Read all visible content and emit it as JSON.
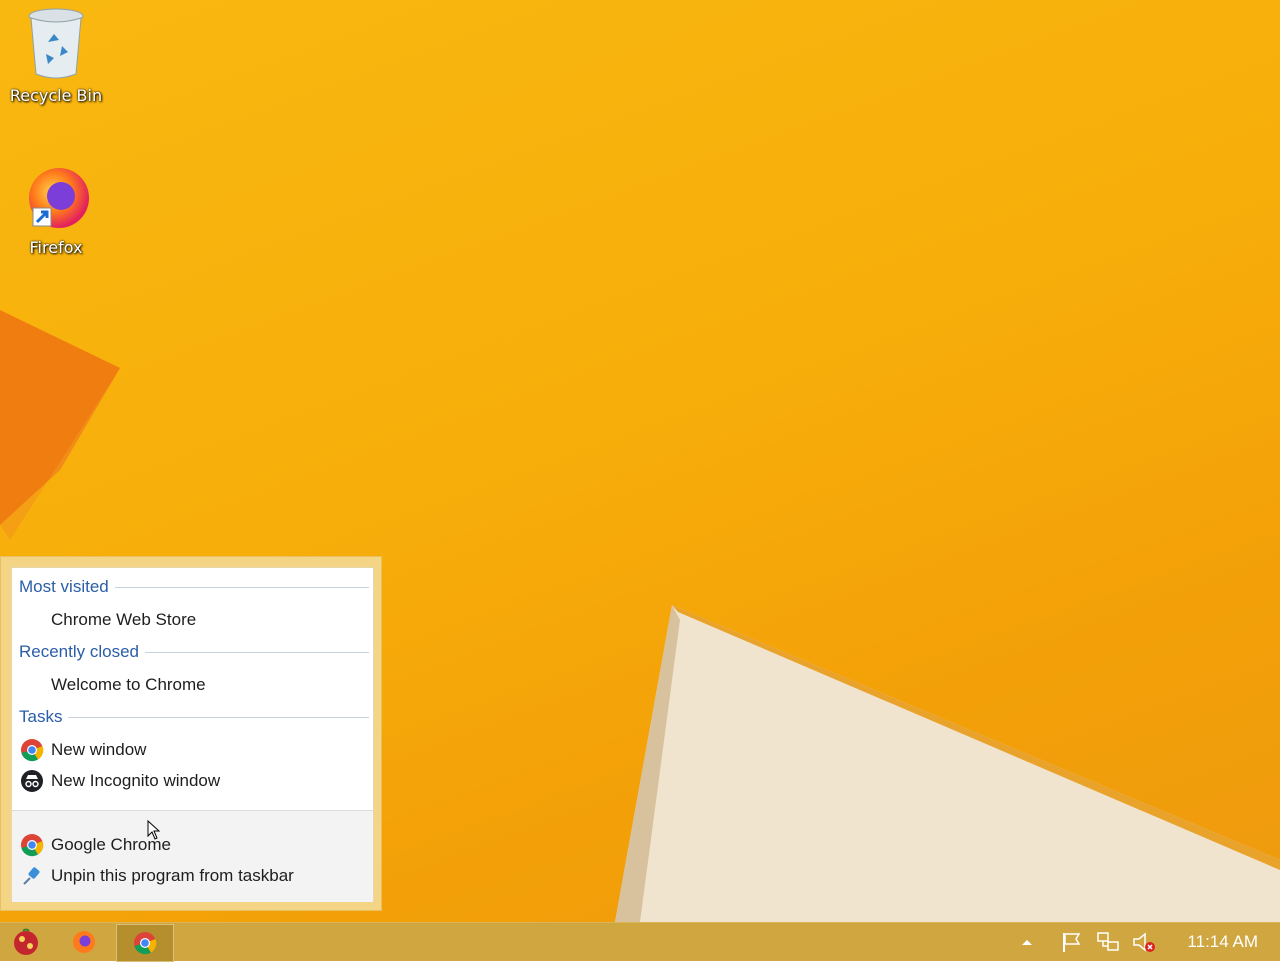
{
  "desktop": {
    "icons": [
      {
        "label": "Recycle Bin"
      },
      {
        "label": "Firefox"
      }
    ]
  },
  "jumplist": {
    "most_visited": {
      "header": "Most visited",
      "items": [
        "Chrome Web Store"
      ]
    },
    "recently_closed": {
      "header": "Recently closed",
      "items": [
        "Welcome to Chrome"
      ]
    },
    "tasks": {
      "header": "Tasks",
      "new_window": "New window",
      "new_incognito": "New Incognito window"
    },
    "footer": {
      "app_name": "Google Chrome",
      "unpin": "Unpin this program from taskbar"
    }
  },
  "taskbar": {
    "clock": "11:14 AM"
  },
  "colors": {
    "accent": "#f7ae0a",
    "taskbar": "#cfa640",
    "section_header": "#2a5ea8"
  }
}
